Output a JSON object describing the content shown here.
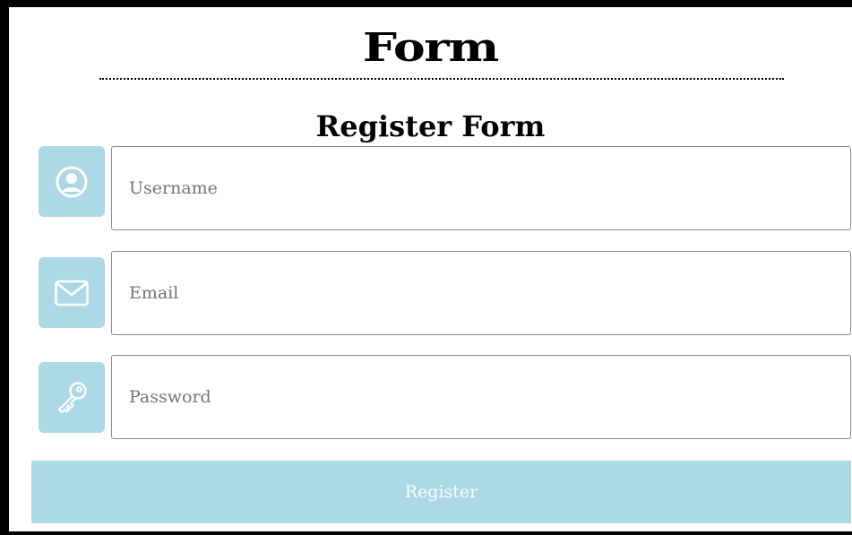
{
  "header": {
    "title": "Form"
  },
  "form": {
    "title": "Register Form",
    "fields": {
      "username": {
        "placeholder": "Username",
        "value": "",
        "icon": "user-circle-icon"
      },
      "email": {
        "placeholder": "Email",
        "value": "",
        "icon": "envelope-icon"
      },
      "password": {
        "placeholder": "Password",
        "value": "",
        "icon": "key-icon"
      }
    },
    "submit_label": "Register"
  },
  "colors": {
    "accent": "#add8e6",
    "border": "#000000",
    "button_text": "#ffffff"
  }
}
